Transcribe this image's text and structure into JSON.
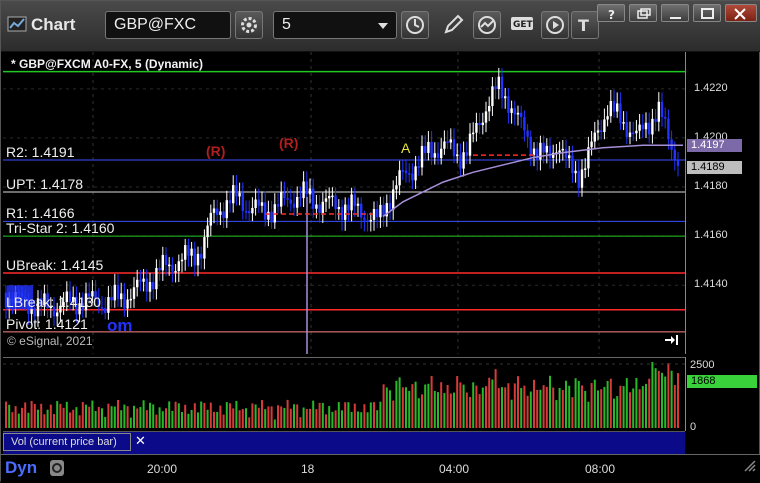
{
  "window": {
    "title": "Chart"
  },
  "toolbar": {
    "symbol": "GBP@FXC",
    "interval": "5"
  },
  "chart": {
    "header": "* GBP@FXCM A0-FX, 5 (Dynamic)",
    "levels": [
      {
        "label": "R2: 1.4191",
        "y": 1.4191,
        "color": "#3a4fff"
      },
      {
        "label": "UPT: 1.4178",
        "y": 1.4178,
        "color": "#dddddd"
      },
      {
        "label": "R1: 1.4166",
        "y": 1.4166,
        "color": "#3a4fff"
      },
      {
        "label": "Tri-Star 2: 1.4160",
        "y": 1.416,
        "color": "#22c822"
      },
      {
        "label": "UBreak: 1.4145",
        "y": 1.4145,
        "color": "#ff2a2a"
      },
      {
        "label": "LBreak: 1.4130",
        "y": 1.413,
        "color": "#ff2a2a"
      },
      {
        "label": "Pivot: 1.4121",
        "y": 1.4121,
        "color": "#ff8888"
      }
    ],
    "top_line": 1.4227,
    "watermark": "© eSignal, 2021",
    "partial_text": "om",
    "annotations": {
      "r1": "(R)",
      "r2": "(R)",
      "a": "A"
    },
    "y_ticks": [
      "1.4220",
      "1.4200",
      "1.4180",
      "1.4160",
      "1.4140"
    ],
    "y_ticks_values": [
      1.422,
      1.42,
      1.418,
      1.416,
      1.414
    ],
    "price_badges": [
      {
        "text": "1.4197",
        "bg": "#7c6aa8",
        "fg": "#ffffff"
      },
      {
        "text": "1.4189",
        "bg": "#bdbdbd",
        "fg": "#000000"
      }
    ],
    "y_range": [
      1.4112,
      1.4235
    ]
  },
  "volume": {
    "label": "Vol (current price bar)",
    "close": "✕",
    "ticks": [
      "2500",
      "0"
    ],
    "badge": "1868",
    "max": 2500
  },
  "xaxis": {
    "ticks": [
      "20:00",
      "18",
      "04:00",
      "08:00"
    ],
    "dyn": "Dyn"
  },
  "colors": {
    "up": "#ffffff",
    "down": "#2233ff",
    "ma": "#a58fd8",
    "vol_up": "#27b927",
    "vol_down": "#d83a3a",
    "accent": "#3aa93a"
  }
}
